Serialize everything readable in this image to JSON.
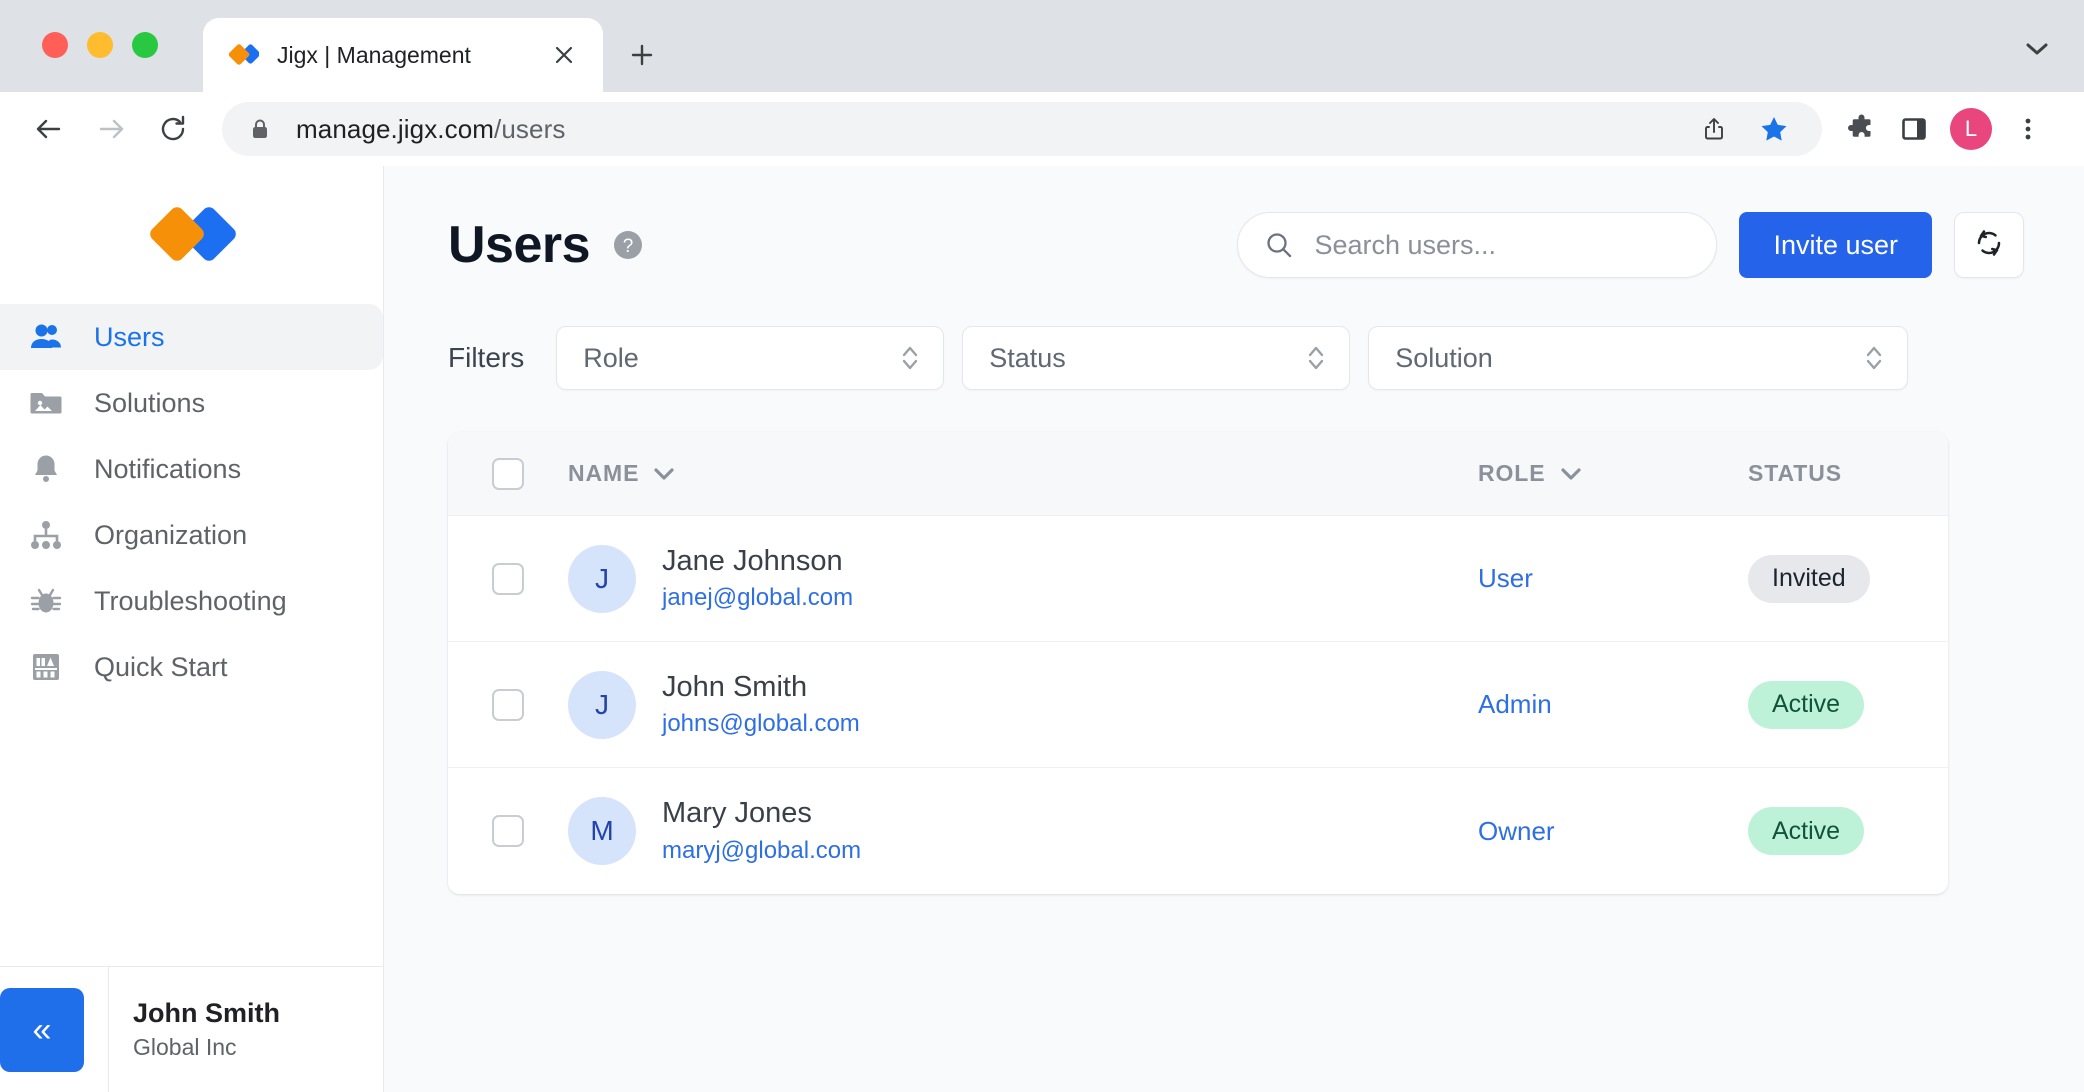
{
  "browser": {
    "tab": {
      "title": "Jigx | Management",
      "favicon": "jigx-diamond-logo-icon",
      "close": "close-icon"
    },
    "new_tab_label": "+",
    "tab_list_icon": "chevron-down-icon",
    "nav": {
      "back": "back-arrow-icon",
      "forward": "forward-arrow-icon",
      "reload": "reload-icon"
    },
    "omnibox": {
      "lock": "lock-icon",
      "url_host": "manage.jigx.com",
      "url_path": "/users",
      "share": "share-icon",
      "bookmark": "star-filled-icon"
    },
    "actions": {
      "extensions": "puzzle-piece-icon",
      "side_panel": "side-panel-icon",
      "profile_initial": "L",
      "menu": "kebab-menu-icon"
    },
    "colors": {
      "bookmark_star": "#1a73e8",
      "profile_avatar": "#e8467c"
    }
  },
  "sidebar": {
    "logo": "jigx-diamond-logo",
    "items": [
      {
        "label": "Users",
        "icon": "users-icon",
        "active": true
      },
      {
        "label": "Solutions",
        "icon": "image-folder-icon",
        "active": false
      },
      {
        "label": "Notifications",
        "icon": "bell-icon",
        "active": false
      },
      {
        "label": "Organization",
        "icon": "org-chart-icon",
        "active": false
      },
      {
        "label": "Troubleshooting",
        "icon": "bug-icon",
        "active": false
      },
      {
        "label": "Quick Start",
        "icon": "bookshelf-icon",
        "active": false
      }
    ],
    "footer": {
      "collapse_icon": "double-chevron-left-icon",
      "user_name": "John Smith",
      "org_name": "Global Inc"
    }
  },
  "main": {
    "title": "Users",
    "help_icon": "help-circle-icon",
    "search": {
      "placeholder": "Search users...",
      "value": "",
      "icon": "search-icon"
    },
    "invite_button": "Invite user",
    "refresh_icon": "refresh-icon",
    "filters": {
      "label": "Filters",
      "role": {
        "placeholder": "Role"
      },
      "status": {
        "placeholder": "Status"
      },
      "solution": {
        "placeholder": "Solution"
      }
    },
    "table": {
      "columns": {
        "name": "NAME",
        "role": "ROLE",
        "status": "STATUS"
      },
      "sort_icon": "chevron-down-icon",
      "rows": [
        {
          "initial": "J",
          "name": "Jane Johnson",
          "email": "janej@global.com",
          "role": "User",
          "status": "Invited",
          "status_type": "invited"
        },
        {
          "initial": "J",
          "name": "John Smith",
          "email": "johns@global.com",
          "role": "Admin",
          "status": "Active",
          "status_type": "active"
        },
        {
          "initial": "M",
          "name": "Mary Jones",
          "email": "maryj@global.com",
          "role": "Owner",
          "status": "Active",
          "status_type": "active"
        }
      ]
    }
  },
  "colors": {
    "brand_orange": "#f79009",
    "brand_blue": "#1d6ff2",
    "primary_button": "#2563eb",
    "link": "#2f6fe4",
    "badge_active_bg": "#bdf2d9",
    "badge_active_text": "#11523a",
    "badge_invited_bg": "#e6e8eb",
    "page_bg": "#f8fafc"
  }
}
